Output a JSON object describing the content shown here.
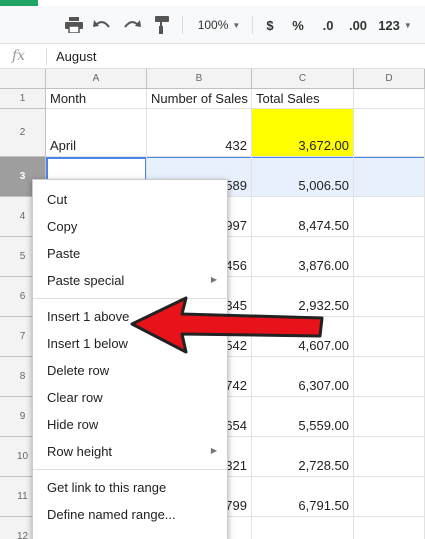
{
  "toolbar": {
    "zoom": "100%",
    "currency": "$",
    "percent": "%",
    "dec_decrease": ".0",
    "dec_increase": ".00",
    "format_more": "123"
  },
  "formula_bar": {
    "fx_label": "fx",
    "value": "August"
  },
  "columns": [
    "A",
    "B",
    "C",
    "D"
  ],
  "rows": [
    {
      "num": "1",
      "a": "Month",
      "b": "Number of Sales",
      "c": "Total Sales"
    },
    {
      "num": "2",
      "a": "April",
      "b": "432",
      "c": "3,672.00"
    },
    {
      "num": "3",
      "a": "",
      "b": "589",
      "c": "5,006.50"
    },
    {
      "num": "4",
      "a": "",
      "b": "997",
      "c": "8,474.50"
    },
    {
      "num": "5",
      "a": "",
      "b": "456",
      "c": "3,876.00"
    },
    {
      "num": "6",
      "a": "",
      "b": "345",
      "c": "2,932.50"
    },
    {
      "num": "7",
      "a": "",
      "b": "542",
      "c": "4,607.00"
    },
    {
      "num": "8",
      "a": "",
      "b": "742",
      "c": "6,307.00"
    },
    {
      "num": "9",
      "a": "",
      "b": "654",
      "c": "5,559.00"
    },
    {
      "num": "10",
      "a": "",
      "b": "321",
      "c": "2,728.50"
    },
    {
      "num": "11",
      "a": "",
      "b": "799",
      "c": "6,791.50"
    },
    {
      "num": "12",
      "a": "",
      "b": "",
      "c": ""
    }
  ],
  "context_menu": {
    "cut": "Cut",
    "copy": "Copy",
    "paste": "Paste",
    "paste_special": "Paste special",
    "insert_above": "Insert 1 above",
    "insert_below": "Insert 1 below",
    "delete_row": "Delete row",
    "clear_row": "Clear row",
    "hide_row": "Hide row",
    "row_height": "Row height",
    "get_link": "Get link to this range",
    "define_named_range": "Define named range..."
  },
  "colors": {
    "highlight_yellow": "#ffff00",
    "selection_blue": "#4a86e8",
    "annotation_arrow": "#e8131a",
    "brand_green": "#1fa463"
  },
  "icons": [
    "print-icon",
    "undo-icon",
    "redo-icon",
    "paint-format-icon"
  ]
}
